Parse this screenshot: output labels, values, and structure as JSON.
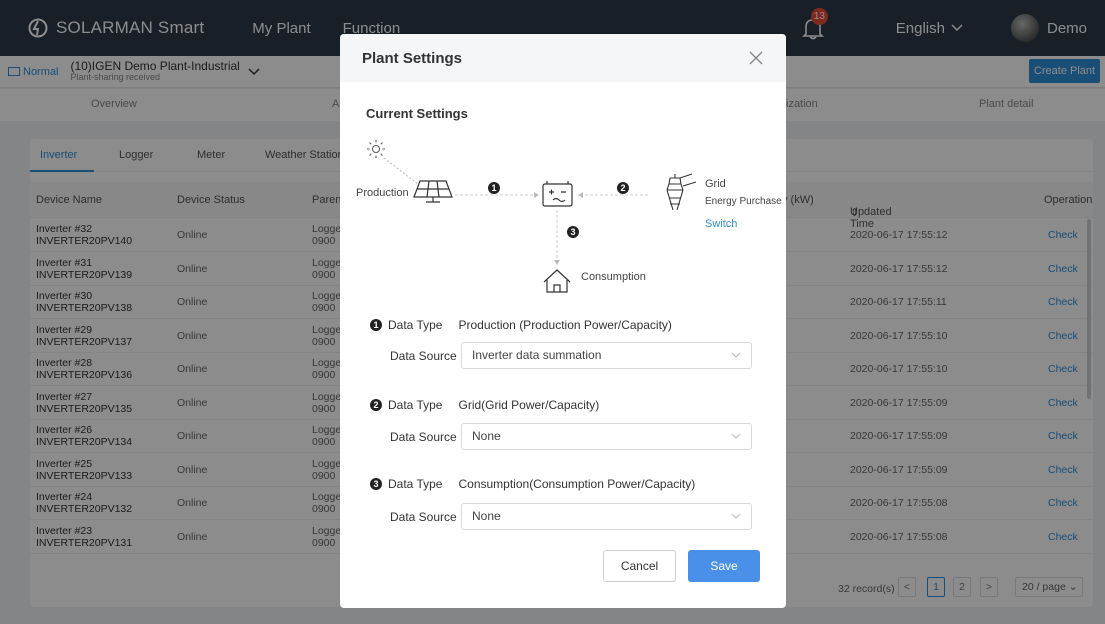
{
  "topbar": {
    "brand": "SOLARMAN Smart",
    "nav": [
      "My Plant",
      "Function"
    ],
    "notification_count": "13",
    "language": "English",
    "user": "Demo"
  },
  "plantbar": {
    "status": "Normal",
    "plant_name": "(10)IGEN Demo Plant-Industrial",
    "plant_sub": "Plant-sharing received",
    "create_label": "Create Plant"
  },
  "tabs": [
    "Overview",
    "A",
    "ization",
    "Plant detail"
  ],
  "subtabs": [
    "Inverter",
    "Logger",
    "Meter",
    "Weather Station"
  ],
  "table": {
    "headers": [
      "Device Name",
      "Device Status",
      "Paren",
      "y (kW)",
      "Updated Time",
      "Operation"
    ],
    "rows": [
      {
        "name": "Inverter #32",
        "sn": "INVERTER20PV140",
        "status": "Online",
        "p1": "Logge",
        "p2": "0900",
        "time": "2020-06-17 17:55:12",
        "op": "Check"
      },
      {
        "name": "Inverter #31",
        "sn": "INVERTER20PV139",
        "status": "Online",
        "p1": "Logge",
        "p2": "0900",
        "time": "2020-06-17 17:55:12",
        "op": "Check"
      },
      {
        "name": "Inverter #30",
        "sn": "INVERTER20PV138",
        "status": "Online",
        "p1": "Logge",
        "p2": "0900",
        "time": "2020-06-17 17:55:11",
        "op": "Check"
      },
      {
        "name": "Inverter #29",
        "sn": "INVERTER20PV137",
        "status": "Online",
        "p1": "Logge",
        "p2": "0900",
        "time": "2020-06-17 17:55:10",
        "op": "Check"
      },
      {
        "name": "Inverter #28",
        "sn": "INVERTER20PV136",
        "status": "Online",
        "p1": "Logge",
        "p2": "0900",
        "time": "2020-06-17 17:55:10",
        "op": "Check"
      },
      {
        "name": "Inverter #27",
        "sn": "INVERTER20PV135",
        "status": "Online",
        "p1": "Logge",
        "p2": "0900",
        "time": "2020-06-17 17:55:09",
        "op": "Check"
      },
      {
        "name": "Inverter #26",
        "sn": "INVERTER20PV134",
        "status": "Online",
        "p1": "Logge",
        "p2": "0900",
        "time": "2020-06-17 17:55:09",
        "op": "Check"
      },
      {
        "name": "Inverter #25",
        "sn": "INVERTER20PV133",
        "status": "Online",
        "p1": "Logge",
        "p2": "0900",
        "time": "2020-06-17 17:55:09",
        "op": "Check"
      },
      {
        "name": "Inverter #24",
        "sn": "INVERTER20PV132",
        "status": "Online",
        "p1": "Logge",
        "p2": "0900",
        "time": "2020-06-17 17:55:08",
        "op": "Check"
      },
      {
        "name": "Inverter #23",
        "sn": "INVERTER20PV131",
        "status": "Online",
        "p1": "Logge",
        "p2": "0900",
        "time": "2020-06-17 17:55:08",
        "op": "Check"
      }
    ]
  },
  "pager": {
    "records": "32 record(s)",
    "prev": "<",
    "pages": [
      "1",
      "2"
    ],
    "next": ">",
    "page_size": "20 / page"
  },
  "modal": {
    "title": "Plant Settings",
    "current_settings": "Current Settings",
    "diagram": {
      "production": "Production",
      "grid": "Grid",
      "energy_purchase": "Energy Purchase",
      "switch": "Switch",
      "consumption": "Consumption",
      "n1": "1",
      "n2": "2",
      "n3": "3"
    },
    "settings": [
      {
        "num": "1",
        "type_label": "Data Type",
        "type_value": "Production (Production Power/Capacity)",
        "source_label": "Data Source",
        "source_value": "Inverter data summation"
      },
      {
        "num": "2",
        "type_label": "Data Type",
        "type_value": "Grid(Grid Power/Capacity)",
        "source_label": "Data Source",
        "source_value": "None"
      },
      {
        "num": "3",
        "type_label": "Data Type",
        "type_value": "Consumption(Consumption Power/Capacity)",
        "source_label": "Data Source",
        "source_value": "None"
      }
    ],
    "cancel": "Cancel",
    "save": "Save"
  },
  "colors": {
    "topbar": "#2f3a47",
    "accent": "#2f8fd8",
    "save": "#4a90e8",
    "badge": "#e84c3d"
  }
}
